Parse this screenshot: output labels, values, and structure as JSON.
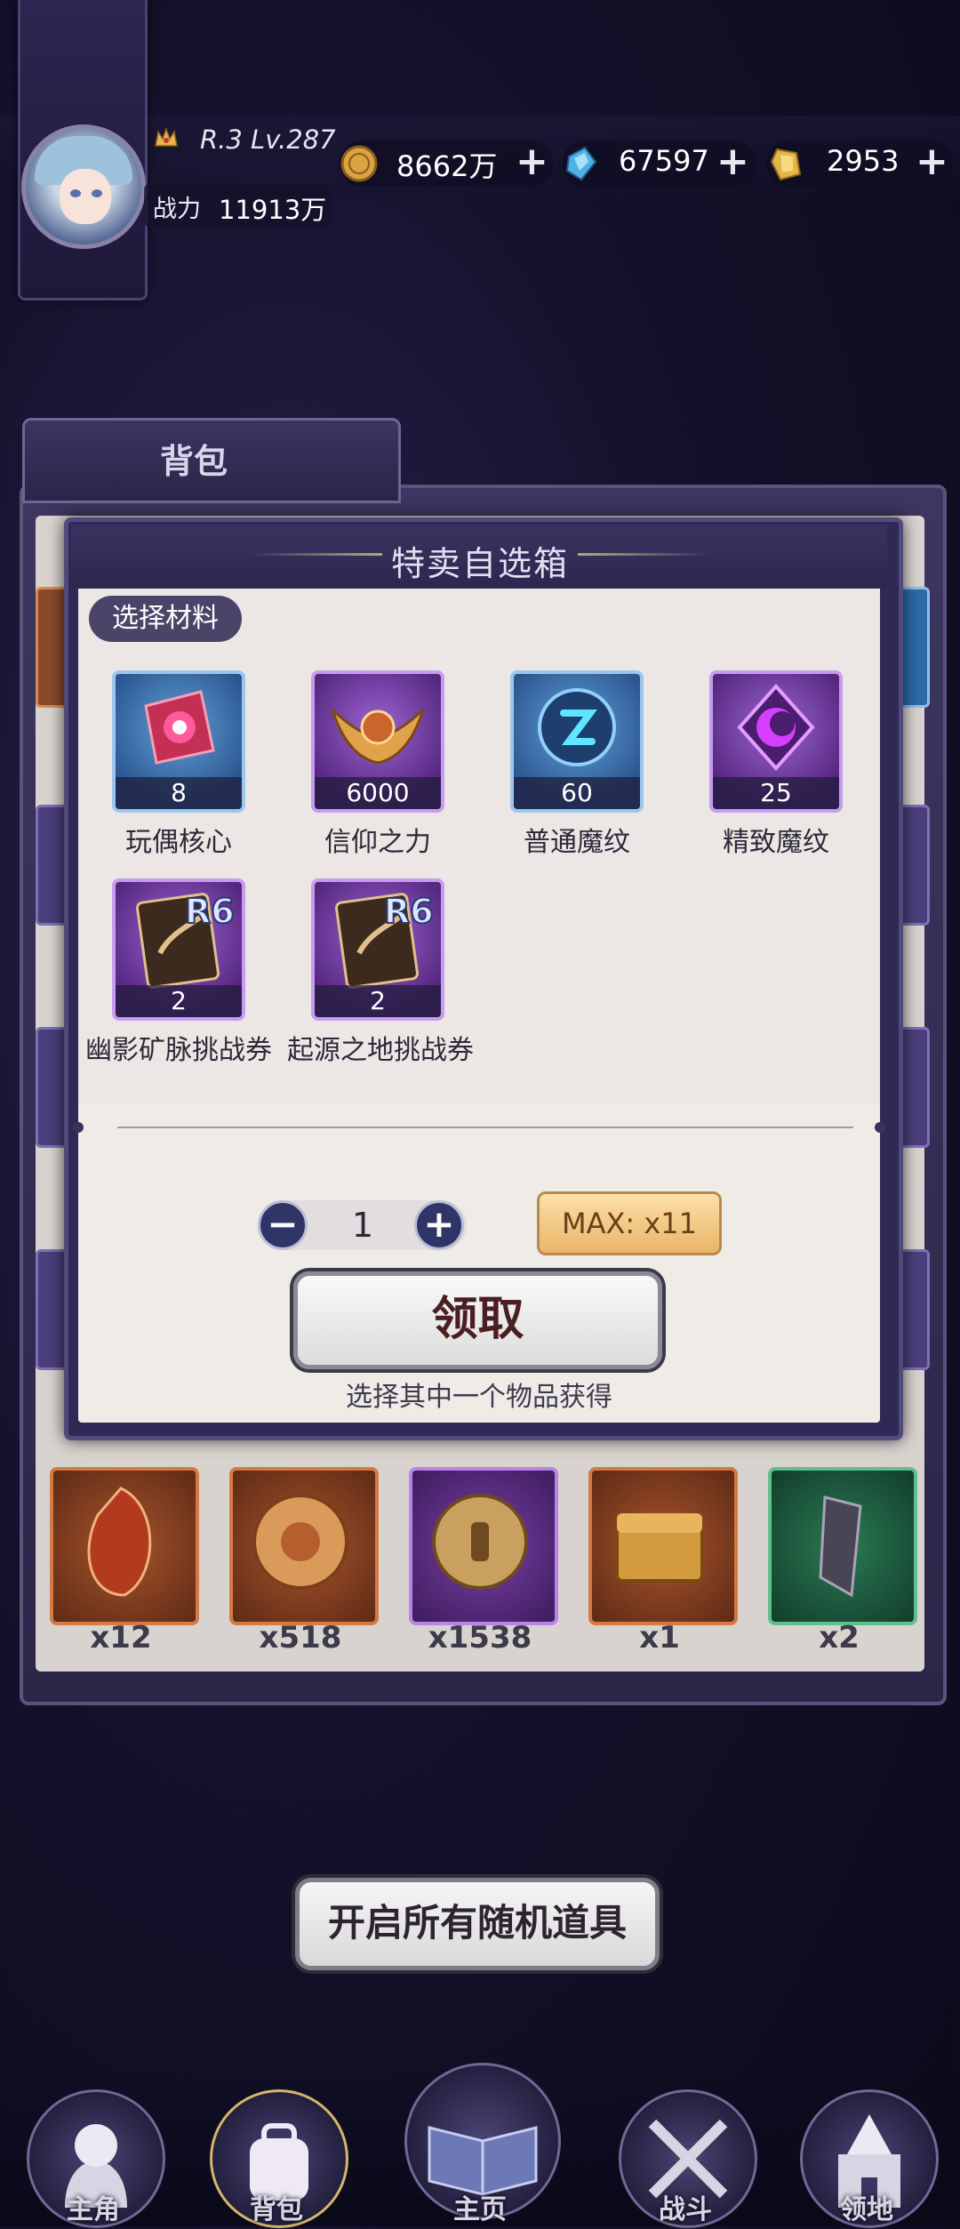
{
  "header": {
    "rank_level": "R.3 Lv.287",
    "power_label": "战力",
    "power_value": "11913万",
    "resources": [
      {
        "icon": "gold-coin-icon",
        "value": "8662万"
      },
      {
        "icon": "blue-crystal-icon",
        "value": "67597"
      },
      {
        "icon": "gold-gem-icon",
        "value": "2953"
      }
    ]
  },
  "backpack": {
    "title": "背包",
    "bottom_items": [
      {
        "icon": "amber-stone-icon",
        "count": "x12"
      },
      {
        "icon": "rose-coin-icon",
        "count": "x518"
      },
      {
        "icon": "chess-coin-icon",
        "count": "x1538"
      },
      {
        "icon": "treasure-chest-icon",
        "count": "x1"
      },
      {
        "icon": "dark-crystal-icon",
        "count": "x2"
      }
    ],
    "open_all_label": "开启所有随机道具"
  },
  "modal": {
    "title": "特卖自选箱",
    "section_label": "选择材料",
    "items": [
      {
        "name": "玩偶核心",
        "count": "8",
        "icon": "doll-core-icon"
      },
      {
        "name": "信仰之力",
        "count": "6000",
        "icon": "faith-wings-icon"
      },
      {
        "name": "普通魔纹",
        "count": "60",
        "icon": "common-rune-icon"
      },
      {
        "name": "精致魔纹",
        "count": "25",
        "icon": "fine-rune-icon"
      },
      {
        "name": "幽影矿脉挑战券",
        "count": "2",
        "icon": "r6-ticket-icon",
        "badge": "R6"
      },
      {
        "name": "起源之地挑战券",
        "count": "2",
        "icon": "r6-ticket-icon",
        "badge": "R6"
      }
    ],
    "quantity": "1",
    "minus": "−",
    "plus": "+",
    "max_label": "MAX: x11",
    "claim_label": "领取",
    "hint": "选择其中一个物品获得"
  },
  "nav": {
    "tabs": [
      {
        "label": "主角",
        "icon": "hero-icon"
      },
      {
        "label": "背包",
        "icon": "bag-icon"
      },
      {
        "label": "主页",
        "icon": "book-icon"
      },
      {
        "label": "战斗",
        "icon": "crossed-swords-icon"
      },
      {
        "label": "领地",
        "icon": "castle-icon"
      }
    ]
  }
}
